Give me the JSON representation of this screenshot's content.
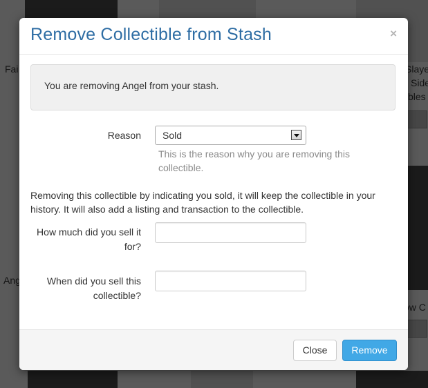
{
  "background": {
    "left_texts": [
      "Fai",
      "Ange"
    ],
    "right_texts": [
      "Slaye",
      "Side",
      "bles",
      "ow C"
    ]
  },
  "modal": {
    "title": "Remove Collectible from Stash",
    "close_symbol": "×",
    "alert_text": "You are removing Angel from your stash.",
    "reason": {
      "label": "Reason",
      "selected": "Sold",
      "help": "This is the reason why you are removing this collectible."
    },
    "description": "Removing this collectible by indicating you sold, it will keep the collectible in your history. It will also add a listing and transaction to the collectible.",
    "price_field": {
      "label": "How much did you sell it for?",
      "value": ""
    },
    "date_field": {
      "label": "When did you sell this collectible?",
      "value": ""
    },
    "footer": {
      "close_label": "Close",
      "remove_label": "Remove"
    }
  },
  "colors": {
    "title": "#2e6da4",
    "primary_button": "#41a8e6"
  },
  "icons": {
    "dropdown": "chevron-down-icon",
    "close": "close-icon"
  }
}
